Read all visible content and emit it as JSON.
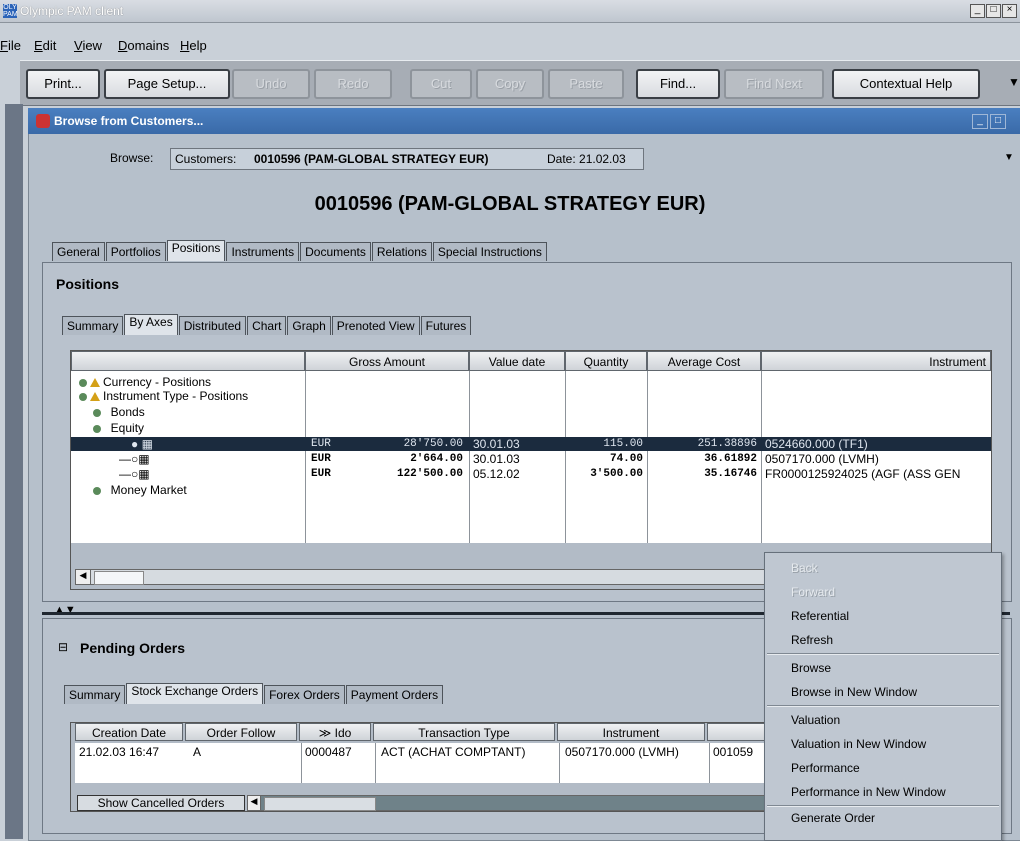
{
  "app": {
    "title": "Olympic PAM client",
    "icon_label": "OLY PAM"
  },
  "menu": [
    {
      "label": "File",
      "ul": "F",
      "rest": "ile"
    },
    {
      "label": "Edit",
      "ul": "E",
      "rest": "dit"
    },
    {
      "label": "View",
      "ul": "V",
      "rest": "iew"
    },
    {
      "label": "Domains",
      "ul": "D",
      "rest": "omains"
    },
    {
      "label": "Help",
      "ul": "H",
      "rest": "elp"
    }
  ],
  "toolbar": {
    "print": "Print...",
    "page_setup": "Page Setup...",
    "undo": "Undo",
    "redo": "Redo",
    "cut": "Cut",
    "copy": "Copy",
    "paste": "Paste",
    "find": "Find...",
    "find_next": "Find Next",
    "contextual_help": "Contextual Help"
  },
  "inner": {
    "title": "Browse from Customers...",
    "browse_label": "Browse:",
    "browse_prefix": "Customers: ",
    "browse_value": "0010596 (PAM-GLOBAL STRATEGY EUR)",
    "browse_date": "Date: 21.02.03",
    "header": "0010596 (PAM-GLOBAL STRATEGY EUR)"
  },
  "main_tabs": [
    "General",
    "Portfolios",
    "Positions",
    "Instruments",
    "Documents",
    "Relations",
    "Special Instructions"
  ],
  "positions": {
    "title": "Positions",
    "tabs": [
      "Summary",
      "By Axes",
      "Distributed",
      "Chart",
      "Graph",
      "Prenoted View",
      "Futures"
    ],
    "columns": [
      "",
      "Gross Amount",
      "Value date",
      "Quantity",
      "Average Cost",
      "Instrument"
    ],
    "tree": {
      "currency": "Currency - Positions",
      "instrument_type": "Instrument Type - Positions",
      "bonds": "Bonds",
      "equity": "Equity",
      "money_market": "Money Market"
    },
    "rows": [
      {
        "ccy": "EUR",
        "amount": "28'750.00",
        "date": "30.01.03",
        "qty": "115.00",
        "cost": "251.38896",
        "instrument": "0524660.000 (TF1)"
      },
      {
        "ccy": "EUR",
        "amount": "2'664.00",
        "date": "30.01.03",
        "qty": "74.00",
        "cost": "36.61892",
        "instrument": "0507170.000 (LVMH)"
      },
      {
        "ccy": "EUR",
        "amount": "122'500.00",
        "date": "05.12.02",
        "qty": "3'500.00",
        "cost": "35.16746",
        "instrument": "FR0000125924025 (AGF (ASS GEN"
      }
    ]
  },
  "pending": {
    "title": "Pending Orders",
    "tabs": [
      "Summary",
      "Stock Exchange Orders",
      "Forex Orders",
      "Payment Orders"
    ],
    "columns": [
      "Creation Date",
      "Order Follow",
      "Ido",
      "Transaction Type",
      "Instrument",
      ""
    ],
    "rows": [
      {
        "date": "21.02.03 16:47",
        "follow": "A",
        "ido": "0000487",
        "type": "ACT (ACHAT COMPTANT)",
        "instrument": "0507170.000 (LVMH)",
        "extra": "001059"
      }
    ],
    "show_cancelled": "Show Cancelled Orders"
  },
  "context_menu": [
    {
      "label": "Back",
      "enabled": false
    },
    {
      "label": "Forward",
      "enabled": false
    },
    {
      "label": "Referential",
      "enabled": true
    },
    {
      "label": "Refresh",
      "enabled": true
    },
    {
      "label": "Browse",
      "enabled": true
    },
    {
      "label": "Browse in New Window",
      "enabled": true
    },
    {
      "label": "Valuation",
      "enabled": true
    },
    {
      "label": "Valuation in New Window",
      "enabled": true
    },
    {
      "label": "Performance",
      "enabled": true
    },
    {
      "label": "Performance in New Window",
      "enabled": true
    },
    {
      "label": "Generate Order",
      "enabled": true
    }
  ]
}
